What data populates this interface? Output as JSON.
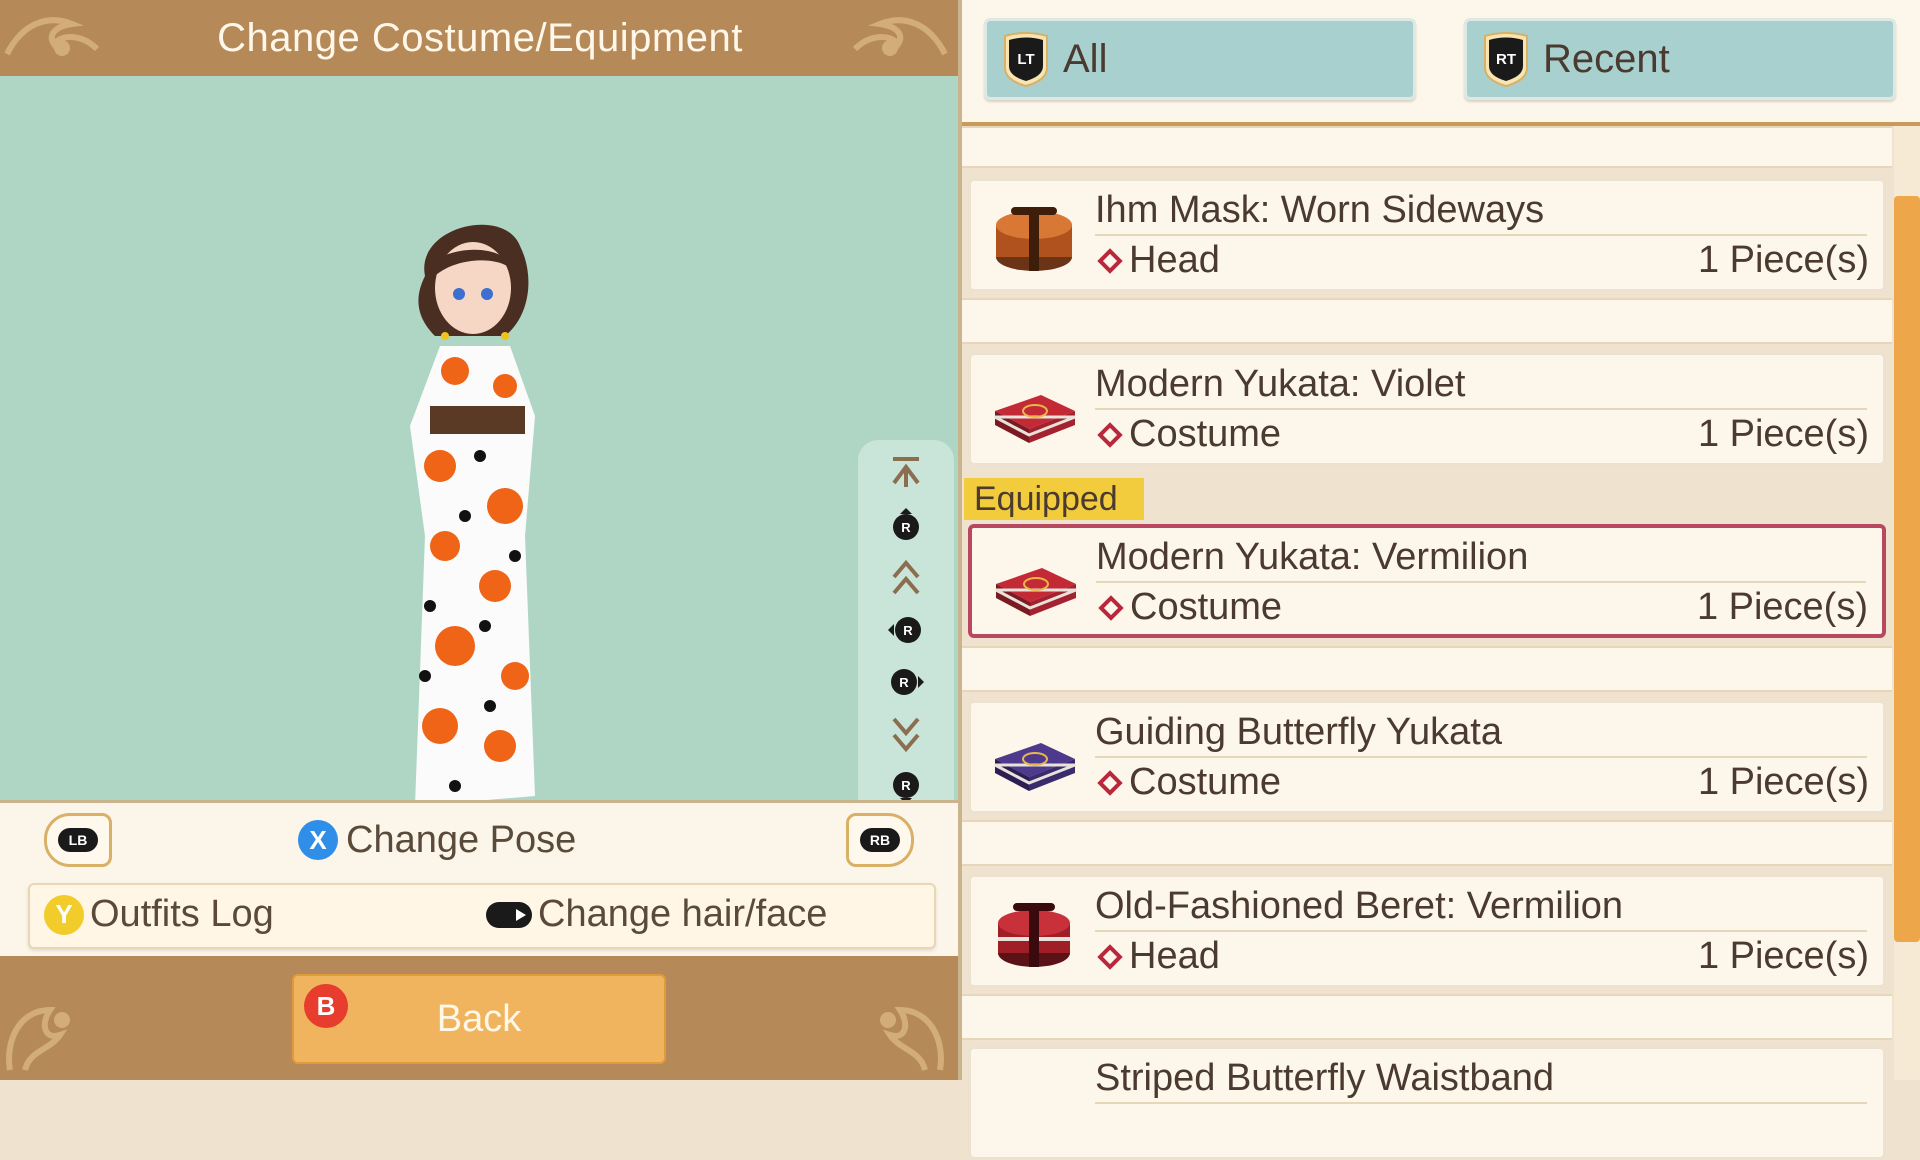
{
  "header": {
    "title": "Change Costume/Equipment"
  },
  "controls": {
    "lb_label": "LB",
    "rb_label": "RB",
    "x_label": "X",
    "change_pose": "Change Pose",
    "y_label": "Y",
    "outfits_log": "Outfits Log",
    "change_hair_face": "Change hair/face",
    "b_label": "B",
    "back": "Back"
  },
  "camera": {
    "r_label": "R"
  },
  "tabs": [
    {
      "trigger": "LT",
      "label": "All"
    },
    {
      "trigger": "RT",
      "label": "Recent"
    }
  ],
  "equipped_label": "Equipped",
  "items": [
    {
      "name": "Ihm Mask: Worn Sideways",
      "type": "Head",
      "qty": "1 Piece(s)",
      "icon": "brown-round-box-icon",
      "equipped": false
    },
    {
      "name": "Modern Yukata: Violet",
      "type": "Costume",
      "qty": "1 Piece(s)",
      "icon": "red-flat-box-icon",
      "equipped": false
    },
    {
      "name": "Modern Yukata: Vermilion",
      "type": "Costume",
      "qty": "1 Piece(s)",
      "icon": "red-flat-box-icon",
      "equipped": true
    },
    {
      "name": "Guiding Butterfly Yukata",
      "type": "Costume",
      "qty": "1 Piece(s)",
      "icon": "purple-flat-box-icon",
      "equipped": false
    },
    {
      "name": "Old-Fashioned Beret: Vermilion",
      "type": "Head",
      "qty": "1 Piece(s)",
      "icon": "red-round-box-icon",
      "equipped": false
    },
    {
      "name": "Striped Butterfly Waistband",
      "type": "",
      "qty": "",
      "icon": "",
      "equipped": false
    }
  ],
  "colors": {
    "header_brown": "#b58a58",
    "stage_green": "#afd6c5",
    "tab_teal": "#a7d0cf",
    "equipped_border": "#b84860",
    "equipped_badge": "#f2cc3c",
    "scroll_orange": "#eea64a"
  }
}
